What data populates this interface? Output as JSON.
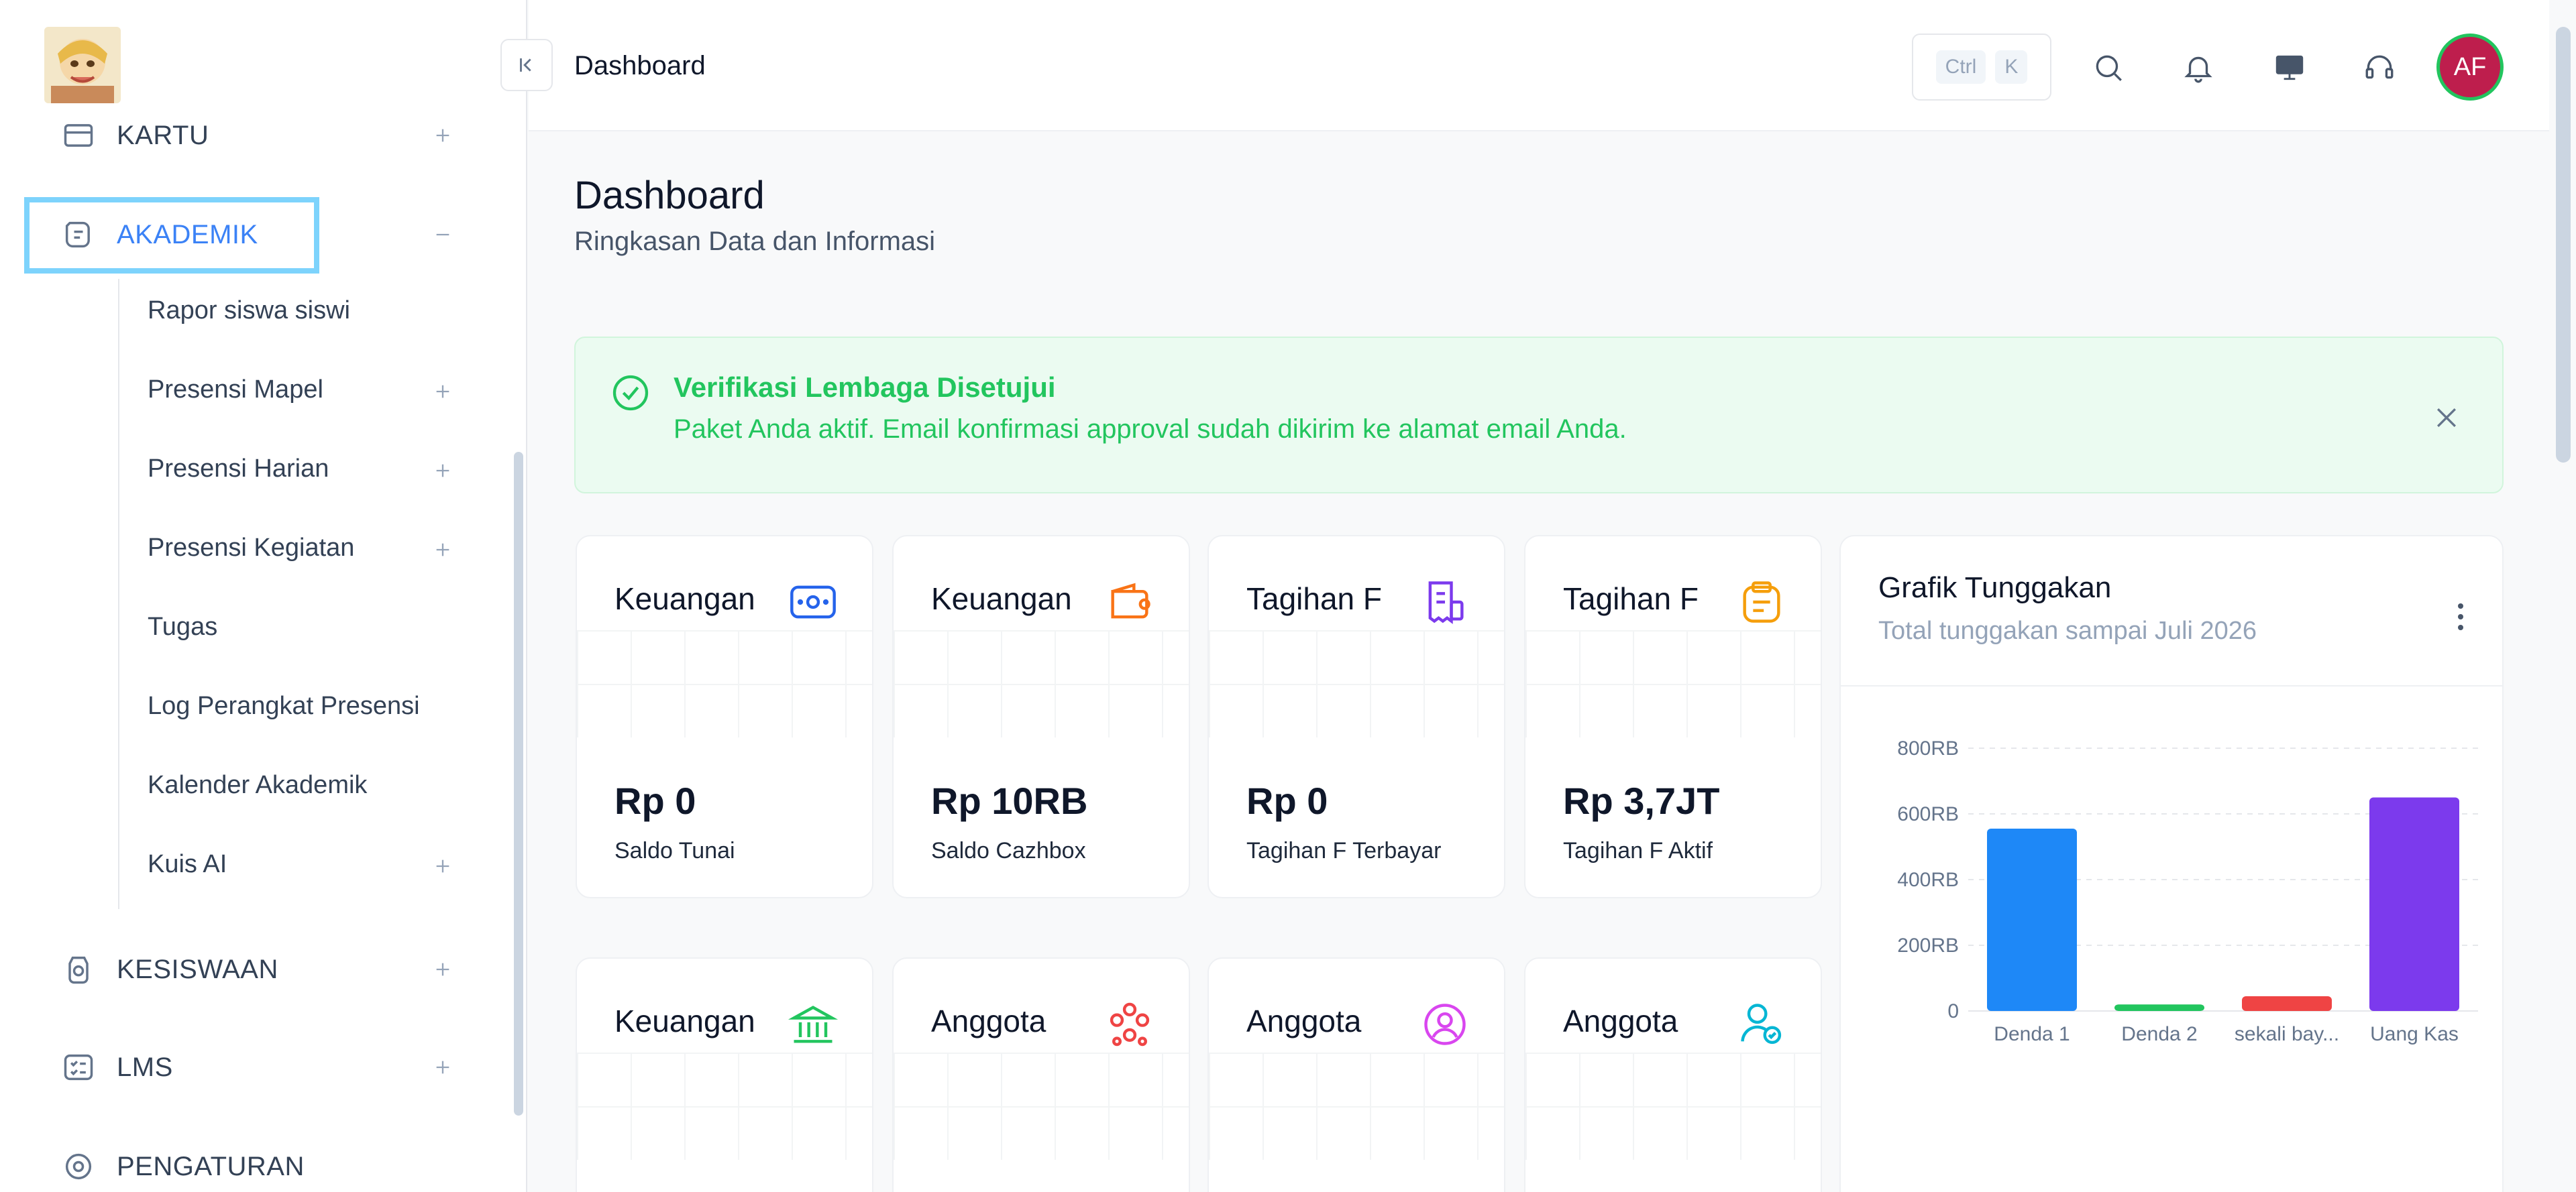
{
  "sidebar": {
    "items": [
      {
        "label": "KARTU",
        "expanded": false
      },
      {
        "label": "AKADEMIK",
        "expanded": true
      },
      {
        "label": "KESISWAAN",
        "expanded": false
      },
      {
        "label": "LMS",
        "expanded": false
      },
      {
        "label": "PENGATURAN",
        "expanded": false
      }
    ],
    "akademik_children": [
      {
        "label": "Rapor siswa siswi",
        "has_children": false
      },
      {
        "label": "Presensi Mapel",
        "has_children": true
      },
      {
        "label": "Presensi Harian",
        "has_children": true
      },
      {
        "label": "Presensi Kegiatan",
        "has_children": true
      },
      {
        "label": "Tugas",
        "has_children": false
      },
      {
        "label": "Log Perangkat Presensi",
        "has_children": false
      },
      {
        "label": "Kalender Akademik",
        "has_children": false
      },
      {
        "label": "Kuis AI",
        "has_children": true
      }
    ]
  },
  "header": {
    "breadcrumb": "Dashboard",
    "shortcut_keys": [
      "Ctrl",
      "K"
    ],
    "avatar_initials": "AF",
    "avatar_color": "#be1e4d"
  },
  "page": {
    "title": "Dashboard",
    "subtitle": "Ringkasan Data dan Informasi"
  },
  "alert": {
    "title": "Verifikasi Lembaga Disetujui",
    "message": "Paket Anda aktif. Email konfirmasi approval sudah dikirim ke alamat email Anda."
  },
  "cards": [
    {
      "title": "Keuangan",
      "value": "Rp 0",
      "caption": "Saldo Tunai",
      "icon": "cash-icon",
      "color": "#2563eb"
    },
    {
      "title": "Keuangan",
      "value": "Rp 10RB",
      "caption": "Saldo Cazhbox",
      "icon": "wallet-icon",
      "color": "#f97316"
    },
    {
      "title": "Tagihan F",
      "value": "Rp 0",
      "caption": "Tagihan F Terbayar",
      "icon": "receipt-icon",
      "color": "#7c3aed"
    },
    {
      "title": "Tagihan F",
      "value": "Rp 3,7JT",
      "caption": "Tagihan F Aktif",
      "icon": "clipboard-icon",
      "color": "#f59e0b"
    },
    {
      "title": "Keuangan",
      "icon": "bank-icon",
      "color": "#22c55e"
    },
    {
      "title": "Anggota",
      "icon": "users-group-icon",
      "color": "#ef4444"
    },
    {
      "title": "Anggota",
      "icon": "user-circle-icon",
      "color": "#d946ef"
    },
    {
      "title": "Anggota",
      "icon": "user-check-icon",
      "color": "#06b6d4"
    }
  ],
  "chart_card": {
    "title": "Grafik Tunggakan",
    "subtitle": "Total tunggakan sampai Juli 2026"
  },
  "chart_data": {
    "type": "bar",
    "title": "Grafik Tunggakan",
    "categories": [
      "Denda 1",
      "Denda 2",
      "sekali bay...",
      "Uang Kas"
    ],
    "values": [
      555000,
      20000,
      45000,
      650000
    ],
    "colors": [
      "#1e88f7",
      "#22c55e",
      "#ef4444",
      "#7c3aed"
    ],
    "y_ticks": [
      "0",
      "200RB",
      "400RB",
      "600RB",
      "800RB"
    ],
    "ylim": [
      0,
      800000
    ],
    "grid": true
  }
}
